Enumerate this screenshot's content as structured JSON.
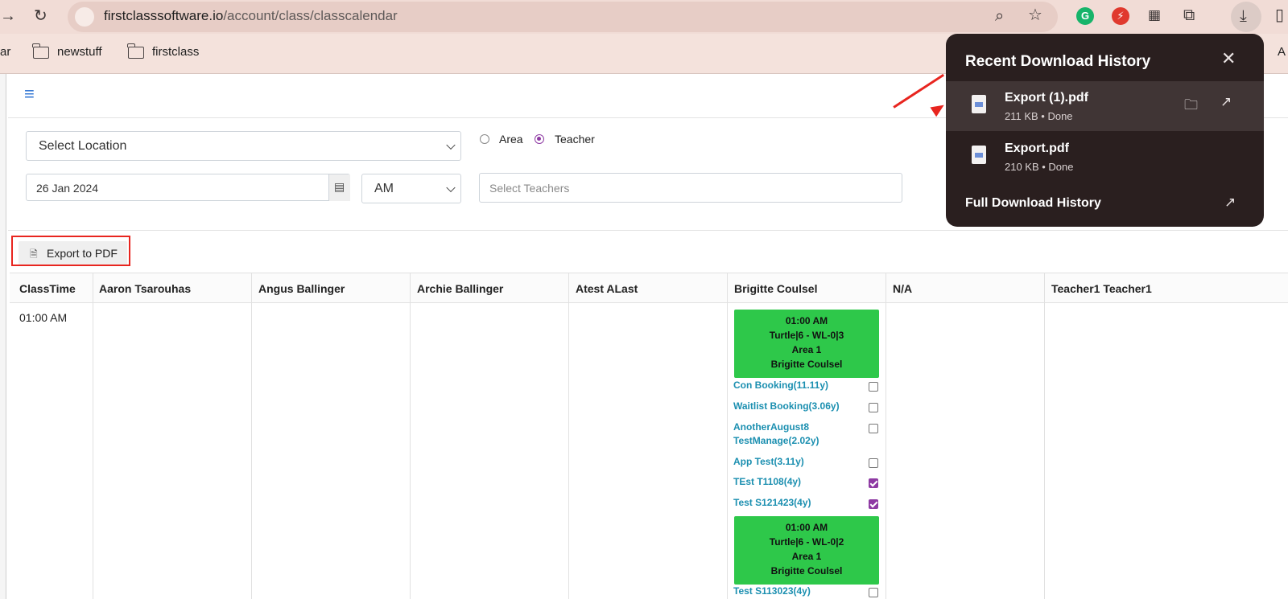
{
  "browser": {
    "url_host": "firstclasssoftware.io",
    "url_path": "/account/class/classcalendar",
    "bookmarks": [
      "ar",
      "newstuff",
      "firstclass",
      "A"
    ]
  },
  "filters": {
    "location_placeholder": "Select Location",
    "radio_options": [
      {
        "label": "Area",
        "selected": false
      },
      {
        "label": "Teacher",
        "selected": true
      }
    ],
    "date_value": "26 Jan 2024",
    "ampm_value": "AM",
    "teachers_placeholder": "Select Teachers"
  },
  "export_label": "Export to PDF",
  "calendar": {
    "columns": [
      "ClassTime",
      "Aaron Tsarouhas",
      "Angus Ballinger",
      "Archie Ballinger",
      "Atest ALast",
      "Brigitte Coulsel",
      "N/A",
      "Teacher1 Teacher1"
    ],
    "time_slot": "01:00 AM",
    "classes": [
      {
        "time": "01:00 AM",
        "name": "Turtle|6 - WL-0|3",
        "area": "Area 1",
        "teacher": "Brigitte Coulsel",
        "bookings": [
          {
            "name": "Con Booking(11.11y)",
            "checked": false
          },
          {
            "name": "Waitlist Booking(3.06y)",
            "checked": false
          },
          {
            "name": "AnotherAugust8 TestManage(2.02y)",
            "checked": false
          },
          {
            "name": "App Test(3.11y)",
            "checked": false
          },
          {
            "name": "TEst T1108(4y)",
            "checked": true
          },
          {
            "name": "Test S121423(4y)",
            "checked": true
          }
        ]
      },
      {
        "time": "01:00 AM",
        "name": "Turtle|6 - WL-0|2",
        "area": "Area 1",
        "teacher": "Brigitte Coulsel",
        "bookings": [
          {
            "name": "Test S113023(4y)",
            "checked": false
          }
        ]
      }
    ]
  },
  "downloads": {
    "title": "Recent Download History",
    "items": [
      {
        "name": "Export (1).pdf",
        "meta": "211 KB • Done"
      },
      {
        "name": "Export.pdf",
        "meta": "210 KB • Done"
      }
    ],
    "full_history_label": "Full Download History"
  }
}
